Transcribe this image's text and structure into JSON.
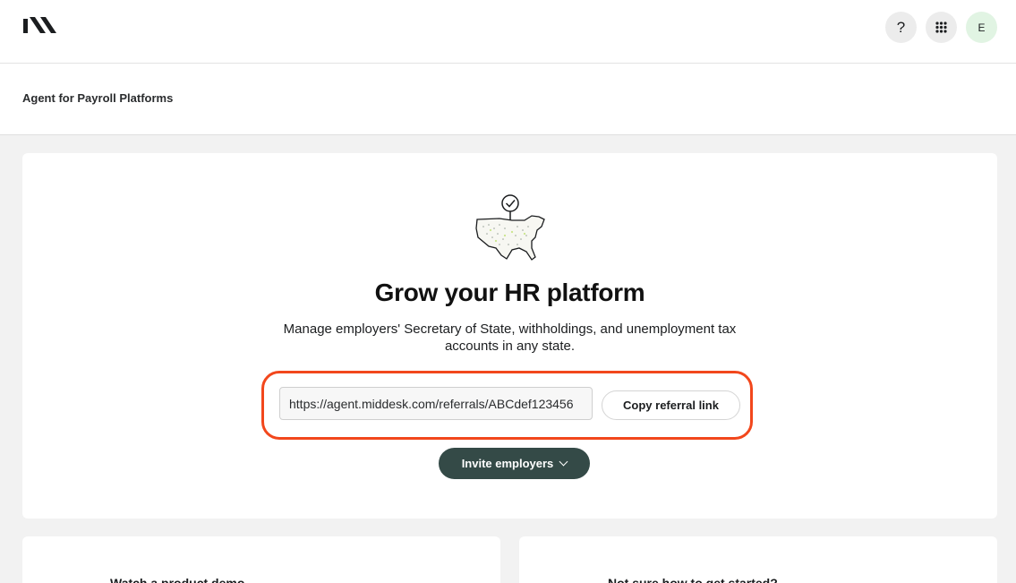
{
  "header": {
    "logo_icon": "middesk-logo-icon",
    "help_label": "?",
    "apps_icon": "grid-dots-icon",
    "avatar_initial": "E"
  },
  "subheader": {
    "title": "Agent for Payroll Platforms"
  },
  "hero": {
    "illustration_icon": "us-map-checkmark-pin-icon",
    "title": "Grow your HR platform",
    "subtitle": "Manage employers' Secretary of State, withholdings, and unemployment tax accounts in any state.",
    "referral_link_value": "https://agent.middesk.com/referrals/ABCdef123456",
    "copy_button_label": "Copy referral link",
    "invite_button_label": "Invite employers",
    "highlight_color": "#f2471c",
    "invite_button_color": "#344a47"
  },
  "bottom_cards": [
    {
      "title": "Watch a product demo"
    },
    {
      "title": "Not sure how to get started?"
    }
  ]
}
